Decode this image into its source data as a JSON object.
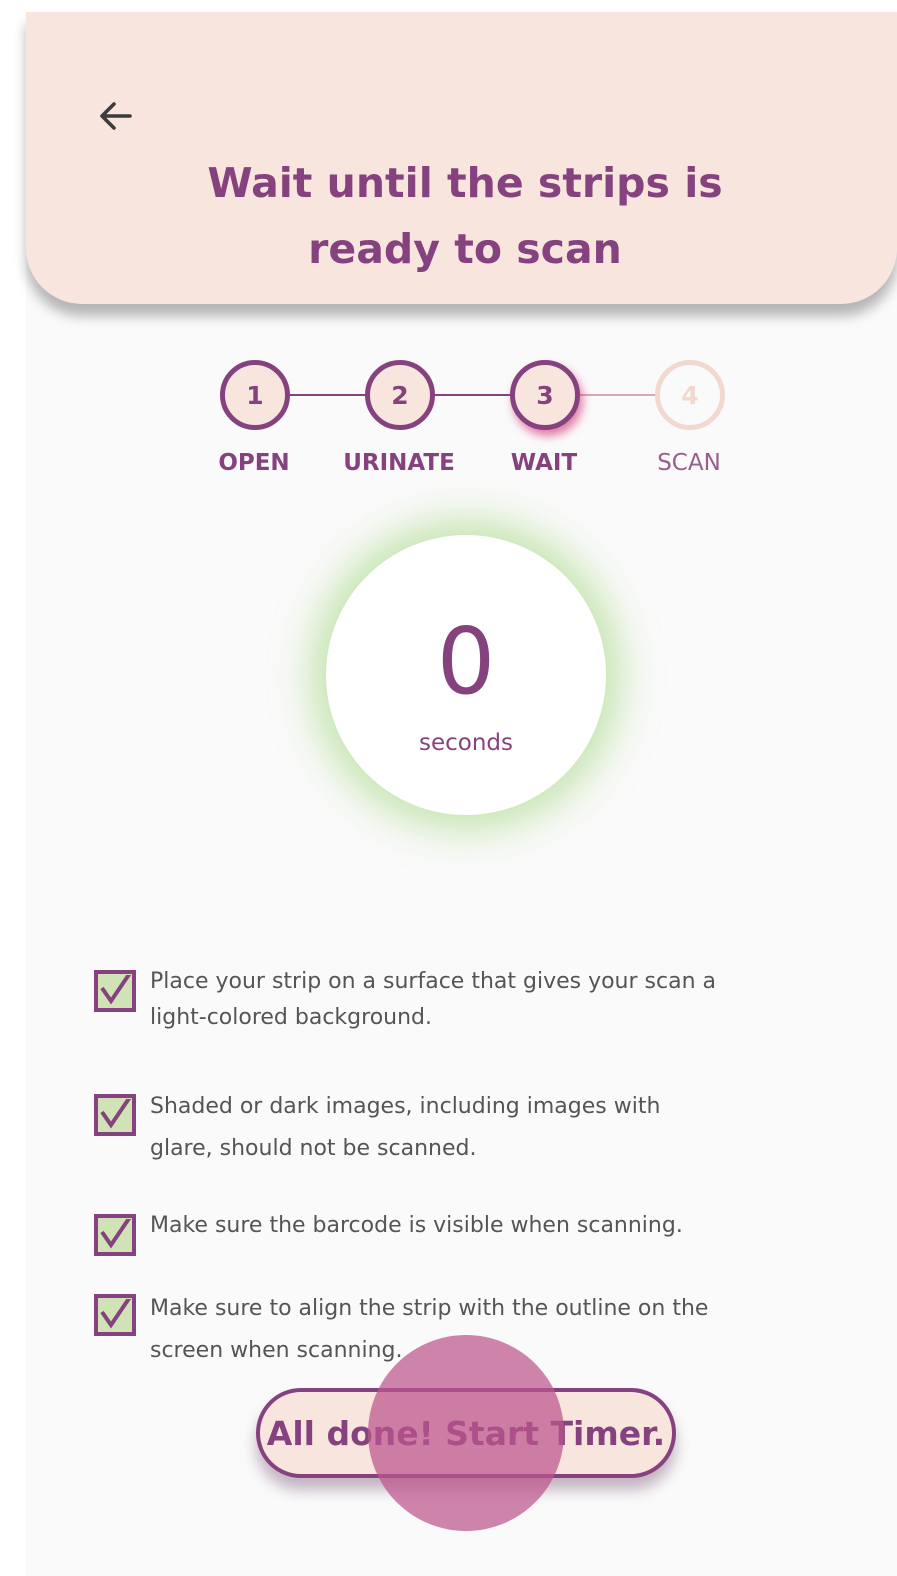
{
  "header": {
    "title": "Wait until the strips is ready to scan",
    "back_icon": "arrow-left-icon"
  },
  "steps": [
    {
      "number": "1",
      "label": "OPEN",
      "state": "complete"
    },
    {
      "number": "2",
      "label": "URINATE",
      "state": "complete"
    },
    {
      "number": "3",
      "label": "WAIT",
      "state": "active"
    },
    {
      "number": "4",
      "label": "SCAN",
      "state": "pending"
    }
  ],
  "timer": {
    "value": "0",
    "unit": "seconds"
  },
  "checklist": [
    {
      "text": "Place your strip on a surface that gives your scan a light-colored background.",
      "checked": true
    },
    {
      "text": "Shaded or dark images, including images with glare, should not be scanned.",
      "checked": true
    },
    {
      "text": "Make sure the barcode is visible when scanning.",
      "checked": true
    },
    {
      "text": "Make sure to align the strip with the outline on the screen when scanning.",
      "checked": true
    }
  ],
  "button": {
    "label": "All done! Start Timer."
  },
  "colors": {
    "primary": "#86427f",
    "header_bg": "#f8e6de",
    "check_fill": "#d1e3b6",
    "timer_glow": "#96d26e",
    "pending_step": "#f2d8cf"
  }
}
